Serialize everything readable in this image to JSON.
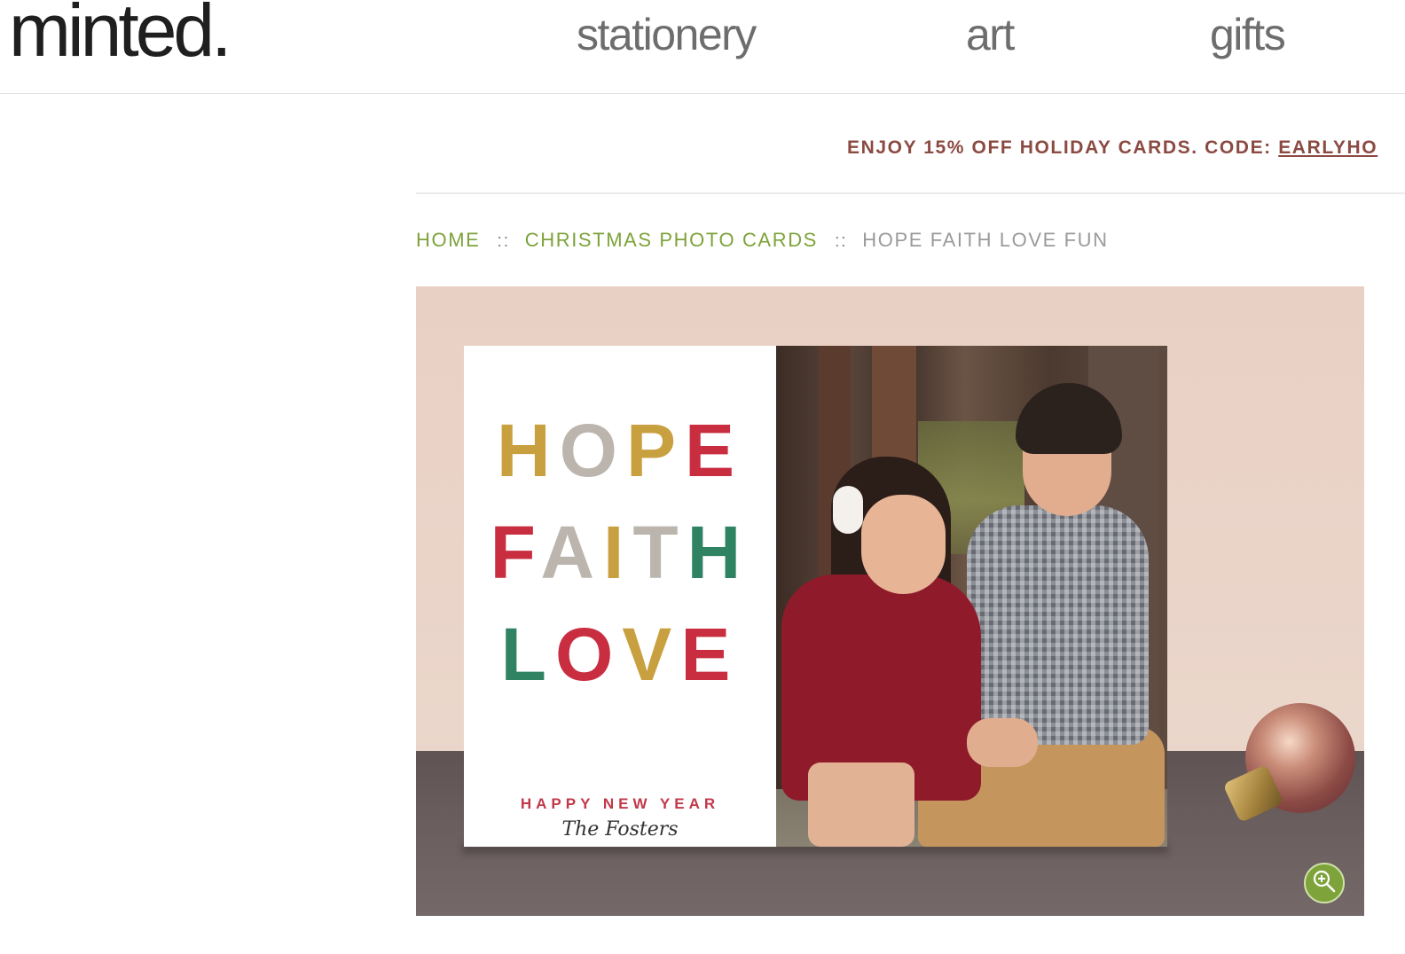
{
  "header": {
    "logo": "minted.",
    "nav": [
      "stationery",
      "art",
      "gifts"
    ]
  },
  "promo": {
    "text": "ENJOY 15% OFF HOLIDAY CARDS. CODE: ",
    "code": "EARLYHO"
  },
  "breadcrumb": {
    "items": [
      "HOME",
      "CHRISTMAS PHOTO CARDS"
    ],
    "separator": "::",
    "current": "HOPE FAITH LOVE FUN"
  },
  "card": {
    "words": [
      "HOPE",
      "FAITH",
      "LOVE"
    ],
    "greeting": "HAPPY NEW YEAR",
    "signature": "The Fosters"
  },
  "colors": {
    "link_green": "#7da33a",
    "promo_brown": "#8b4a42",
    "letter_gold": "#c9a040",
    "letter_green": "#2f8363",
    "letter_red": "#c92d40",
    "letter_grey": "#bcb5ae"
  },
  "icons": {
    "zoom": "zoom-in-icon"
  }
}
